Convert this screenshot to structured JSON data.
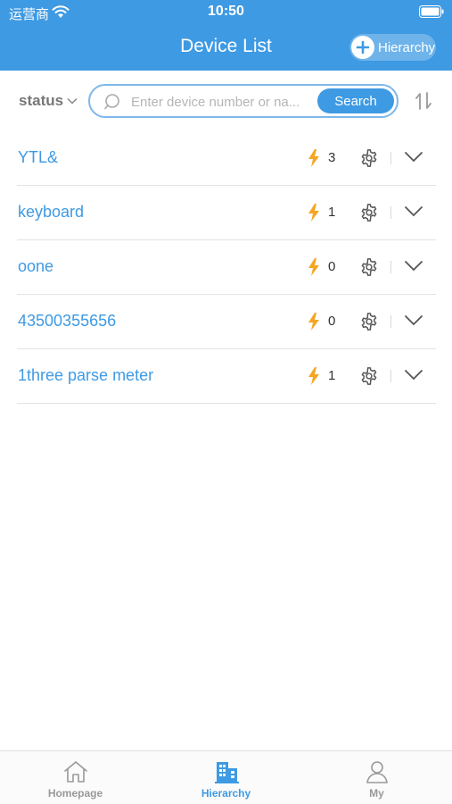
{
  "status_bar": {
    "carrier": "运营商",
    "time": "10:50"
  },
  "header": {
    "title": "Device List",
    "hierarchy_button": "Hierarchy"
  },
  "filter": {
    "status_label": "status",
    "search_placeholder": "Enter device number or na...",
    "search_button": "Search"
  },
  "devices": [
    {
      "name": "YTL&",
      "count": "3"
    },
    {
      "name": "keyboard",
      "count": "1"
    },
    {
      "name": "oone",
      "count": "0"
    },
    {
      "name": "43500355656",
      "count": "0"
    },
    {
      "name": "1three parse meter",
      "count": "1"
    }
  ],
  "tabs": [
    {
      "label": "Homepage",
      "icon": "home-icon",
      "active": false
    },
    {
      "label": "Hierarchy",
      "icon": "building-icon",
      "active": true
    },
    {
      "label": "My",
      "icon": "person-icon",
      "active": false
    }
  ],
  "colors": {
    "accent": "#3e9ae3",
    "bolt": "#f5a623",
    "inactive": "#999999"
  }
}
